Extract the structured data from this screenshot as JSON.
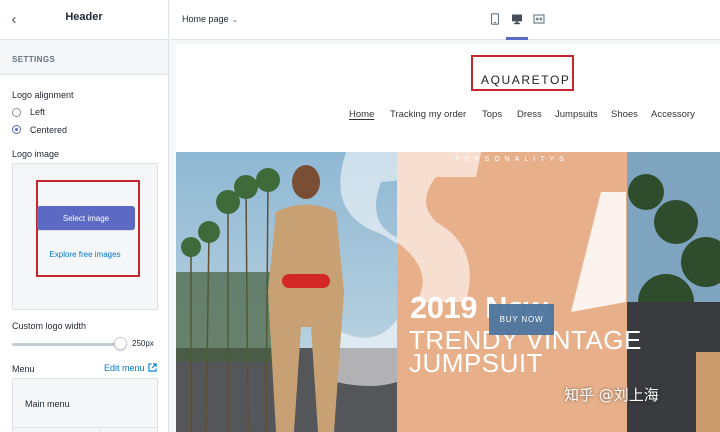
{
  "sidebar": {
    "title": "Header",
    "section_label": "SETTINGS",
    "logo_alignment": {
      "label": "Logo alignment",
      "options": [
        {
          "label": "Left",
          "checked": false
        },
        {
          "label": "Centered",
          "checked": true
        }
      ]
    },
    "logo_image": {
      "label": "Logo image",
      "select_button": "Select image",
      "explore_link": "Explore free images"
    },
    "logo_width": {
      "label": "Custom logo width",
      "value_label": "250px",
      "fraction": 0.93
    },
    "menu": {
      "label": "Menu",
      "edit_link": "Edit menu",
      "selected": "Main menu"
    }
  },
  "topbar": {
    "page_select": "Home page",
    "devices": [
      "mobile-icon",
      "desktop-icon",
      "fullscreen-icon"
    ],
    "active_device": "desktop"
  },
  "preview": {
    "brand": "AQUARETOP",
    "nav": [
      "Home",
      "Tracking my order",
      "Tops",
      "Dress",
      "Jumpsuits",
      "Shoes",
      "Accessory"
    ],
    "active_nav": "Home",
    "hero": {
      "top_banner": "PERSONALITYS",
      "headline_year": "2019 New",
      "headline_line1": "TRENDY VINTAGE",
      "headline_line2": "JUMPSUIT",
      "button": "BUY NOW"
    },
    "watermark": "知乎 @刘上海"
  },
  "colors": {
    "accent": "#5c6ac4",
    "link": "#007ace",
    "highlight": "#c4262e",
    "hero_panel": "#e8b08a",
    "buy_button": "#4d76a0"
  }
}
